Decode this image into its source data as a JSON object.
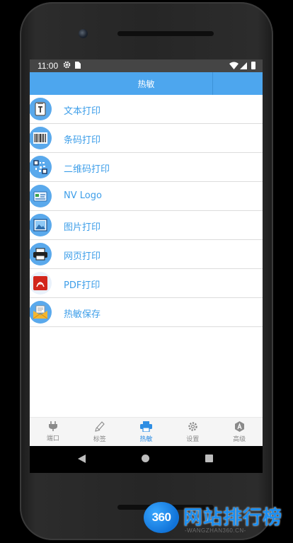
{
  "statusbar": {
    "time": "11:00"
  },
  "appbar": {
    "title": "热敏"
  },
  "menu": [
    {
      "label": "文本打印",
      "icon": "text-doc-icon"
    },
    {
      "label": "条码打印",
      "icon": "barcode-icon"
    },
    {
      "label": "二维码打印",
      "icon": "qrcode-icon"
    },
    {
      "label": "NV Logo",
      "icon": "nv-logo-icon"
    },
    {
      "label": "图片打印",
      "icon": "picture-icon"
    },
    {
      "label": "网页打印",
      "icon": "printer-icon"
    },
    {
      "label": "PDF打印",
      "icon": "pdf-icon"
    },
    {
      "label": "热敏保存",
      "icon": "save-mail-icon"
    }
  ],
  "tabs": [
    {
      "label": "端口",
      "icon": "plug-icon"
    },
    {
      "label": "标签",
      "icon": "tag-pen-icon"
    },
    {
      "label": "热敏",
      "icon": "printer-icon",
      "active": true
    },
    {
      "label": "设置",
      "icon": "gear-icon"
    },
    {
      "label": "高级",
      "icon": "advanced-icon"
    }
  ],
  "watermark": {
    "badge": "360",
    "title": "网站排行榜",
    "url": "-WANGZHAN360.CN-"
  },
  "colors": {
    "accent": "#4da6ee",
    "link": "#3d9ee9",
    "active_tab": "#2f8ee3"
  }
}
